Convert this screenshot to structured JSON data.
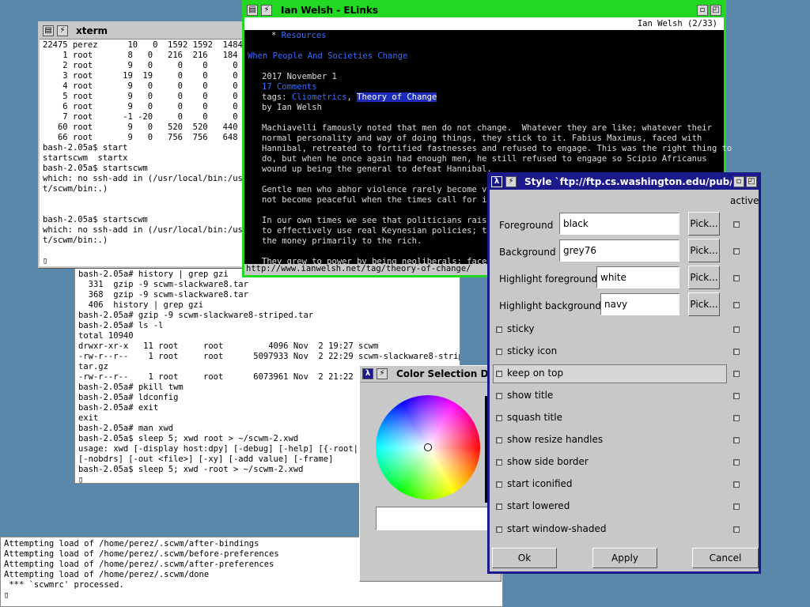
{
  "bottom_console": {
    "lines": "Attempting load of /home/perez/.scwm/after-bindings\nAttempting load of /home/perez/.scwm/before-preferences\nAttempting load of /home/perez/.scwm/after-preferences\nAttempting load of /home/perez/.scwm/done\n *** `scwmrc' processed.\n▯"
  },
  "terminal_mid": {
    "lines": "bash-2.05a# history | grep gzi\n  331  gzip -9 scwm-slackware8.tar\n  368  gzip -9 scwm-slackware8.tar\n  406  history | grep gzi\nbash-2.05a# gzip -9 scwm-slackware8-striped.tar\nbash-2.05a# ls -l\ntotal 10940\ndrwxr-xr-x   11 root     root         4096 Nov  2 19:27 scwm\n-rw-r--r--    1 root     root      5097933 Nov  2 22:29 scwm-slackware8-striped.\ntar.gz\n-rw-r--r--    1 root     root      6073961 Nov  2 21:22 scw\nbash-2.05a# pkill twm\nbash-2.05a# ldconfig\nbash-2.05a# exit\nexit\nbash-2.05a# man xwd\nbash-2.05a$ sleep 5; xwd root > ~/scwm-2.xwd\nusage: xwd [-display host:dpy] [-debug] [-help] [{-root|-id\n[-nobdrs] [-out <file>] [-xy] [-add value] [-frame]\nbash-2.05a$ sleep 5; xwd -root > ~/scwm-2.xwd\n▯"
  },
  "xterm": {
    "title": "xterm",
    "lines": "22475 perez      10   0  1592 1592  1484 S\n    1 root       8   0   216  216   184 S\n    2 root       9   0     0    0     0 SW\n    3 root      19  19     0    0     0 SW\n    4 root       9   0     0    0     0 SW\n    5 root       9   0     0    0     0 SW\n    6 root       9   0     0    0     0 SW\n    7 root      -1 -20     0    0     0 SW\n   60 root       9   0   520  520   440 S\n   66 root       9   0   756  756   648 S\nbash-2.05a$ start\nstartscwm  startx\nbash-2.05a$ startscwm\nwhich: no ssh-add in (/usr/local/bin:/usr/\nt/scwm/bin:.)\n\n\nbash-2.05a$ startscwm\nwhich: no ssh-add in (/usr/local/bin:/usr/\nt/scwm/bin:.)\n\n▯"
  },
  "elinks": {
    "title": "Ian Welsh - ELinks",
    "page_indicator": "Ian Welsh (2/33)",
    "resources_link": "Resources",
    "headline": "When People And Societies Change",
    "date": "2017 November 1",
    "comments": "17 Comments",
    "tags_prefix": "tags: ",
    "tag1": "Cliometrics",
    "tag_sep": ", ",
    "tag2": "Theory of Change",
    "byline": "by Ian Welsh",
    "para1": "Machiavelli famously noted that men do not change.  Whatever they are like; whatever their\nnormal personality and way of doing things, they stick to it. Fabius Maximus, faced with\nHannibal, retreated to fortified fastnesses and refused to engage. This was the right thing to\ndo, but when he once again had enough men, he still refused to engage so Scipio Africanus\nwound up being the general to defeat Hannibal.",
    "para2": "Gentle men who abhor violence rarely become viol\nnot become peaceful when the times call for it,",
    "para3": "In our own times we see that politicians raised\nto effectively use real Keynesian policies; they\nthe money primarily to the rich.",
    "para4": "They grew to power by being neoliberals; faced w",
    "status_url": "http://www.ianwelsh.net/tag/theory-of-change/"
  },
  "color_dialog": {
    "title": "Color Selection Dial"
  },
  "style_dialog": {
    "title": "Style `ftp://ftp.cs.washington.edu/pub/const",
    "active_label": "active",
    "fields": [
      {
        "label": "Foreground",
        "value": "black",
        "pick": "Pick..."
      },
      {
        "label": "Background",
        "value": "grey76",
        "pick": "Pick..."
      },
      {
        "label": "Highlight foreground",
        "value": "white",
        "pick": "Pick..."
      },
      {
        "label": "Highlight background",
        "value": "navy",
        "pick": "Pick..."
      }
    ],
    "options": [
      "sticky",
      "sticky icon",
      "keep on top",
      "show title",
      "squash title",
      "show resize handles",
      "show side border",
      "start iconified",
      "start lowered",
      "start window-shaded"
    ],
    "buttons": {
      "ok": "Ok",
      "apply": "Apply",
      "cancel": "Cancel"
    }
  },
  "colors": {
    "desktop": "#5a88aa",
    "elinks_focus_border": "#22d822",
    "style_frame": "#1a1a8c",
    "link_blue": "#3a6cff"
  }
}
